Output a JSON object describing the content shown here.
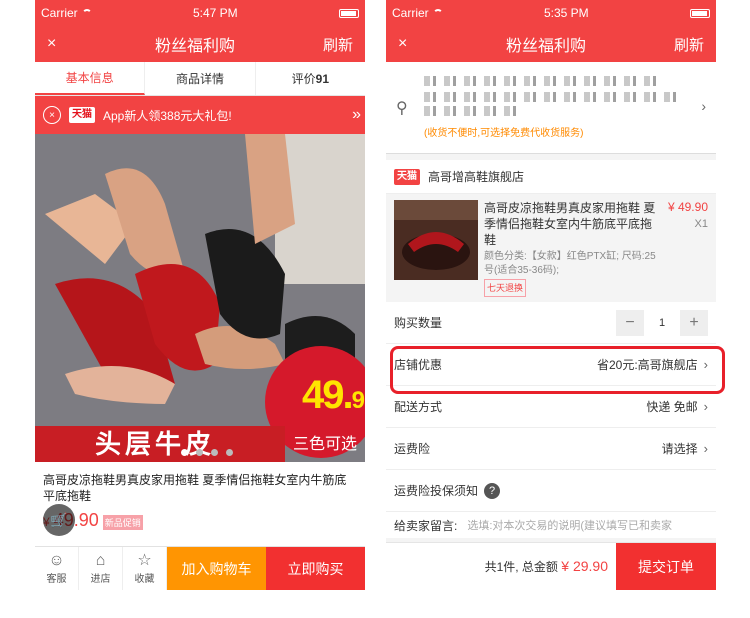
{
  "status_bar": {
    "carrier": "Carrier",
    "left_time": "5:47 PM",
    "right_time": "5:35 PM"
  },
  "left": {
    "nav": {
      "close": "×",
      "title": "粉丝福利购",
      "refresh": "刷新"
    },
    "tabs": [
      {
        "label": "基本信息"
      },
      {
        "label": "商品详情"
      },
      {
        "label": "评价",
        "count": "91"
      }
    ],
    "promo": {
      "close": "×",
      "logo": "天猫",
      "text": "App新人领388元大礼包!",
      "arrows": "»"
    },
    "banner": {
      "headline": "头层牛皮",
      "price_big": "49.",
      "price_small": "9",
      "price_sub": "三色可选",
      "dots_total": 4,
      "dots_active": 1
    },
    "product": {
      "name": "高哥皮凉拖鞋男真皮家用拖鞋 夏季情侣拖鞋女室内牛筋底平底拖鞋",
      "currency": "¥",
      "price": "49.90",
      "tag": "新品促销"
    },
    "bottom_bar": {
      "service": "客服",
      "shop": "进店",
      "favorite": "收藏",
      "add_cart": "加入购物车",
      "buy_now": "立即购买"
    }
  },
  "right": {
    "nav": {
      "close": "×",
      "title": "粉丝福利购",
      "refresh": "刷新"
    },
    "address": {
      "note": "(收货不便时,可选择免费代收货服务)"
    },
    "shop": {
      "logo": "天猫",
      "name": "高哥增高鞋旗舰店"
    },
    "item": {
      "title": "高哥皮凉拖鞋男真皮家用拖鞋 夏季情侣拖鞋女室内牛筋底平底拖鞋",
      "sku": "颜色分类:【女款】红色PTX缸; 尺码:25号(适合35-36码);",
      "return_tag": "七天退换",
      "price": "¥ 49.90",
      "qty": "X1"
    },
    "rows": {
      "quantity_label": "购买数量",
      "quantity_value": "1",
      "minus": "−",
      "plus": "+",
      "discount_label": "店铺优惠",
      "discount_value": "省20元:高哥旗舰店",
      "shipping_label": "配送方式",
      "shipping_value": "快递 免邮",
      "insurance_label": "运费险",
      "insurance_value": "请选择",
      "insurance_info_label": "运费险投保须知",
      "info_mark": "?",
      "message_label": "给卖家留言:",
      "message_placeholder": "选填:对本次交易的说明(建议填写已和卖家"
    },
    "footer": {
      "summary": "共1件, 总金额",
      "amount": "¥ 29.90",
      "submit": "提交订单"
    }
  }
}
